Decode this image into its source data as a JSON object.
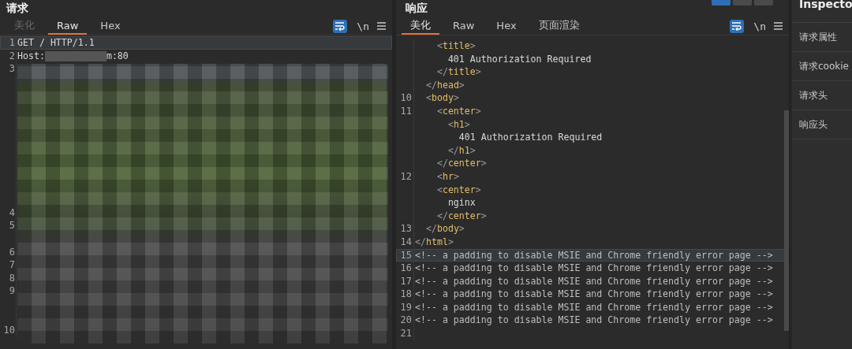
{
  "request": {
    "title": "请求",
    "tabs": [
      {
        "label": "美化",
        "selected": false,
        "disabled": true
      },
      {
        "label": "Raw",
        "selected": true,
        "disabled": false
      },
      {
        "label": "Hex",
        "selected": false,
        "disabled": false
      }
    ],
    "wrap_on": true,
    "newline_label": "\\n",
    "lines": [
      {
        "kind": "code",
        "num": "1",
        "text": "GET / HTTP/1.1",
        "current": true
      },
      {
        "kind": "host",
        "num": "2",
        "text": "Host:",
        "after": "m:80",
        "current": false
      },
      {
        "kind": "code",
        "num": "3",
        "current": false
      },
      {
        "kind": "wrap"
      },
      {
        "kind": "wrap"
      },
      {
        "kind": "wrap"
      },
      {
        "kind": "wrap"
      },
      {
        "kind": "wrap"
      },
      {
        "kind": "wrap"
      },
      {
        "kind": "wrap"
      },
      {
        "kind": "wrap"
      },
      {
        "kind": "wrap"
      },
      {
        "kind": "wrap"
      },
      {
        "kind": "code",
        "num": "4",
        "current": false
      },
      {
        "kind": "code",
        "num": "5",
        "current": false
      },
      {
        "kind": "wrap"
      },
      {
        "kind": "code",
        "num": "6",
        "current": false
      },
      {
        "kind": "code",
        "num": "7",
        "current": false
      },
      {
        "kind": "code",
        "num": "8",
        "current": false
      },
      {
        "kind": "code",
        "num": "9",
        "current": false
      },
      {
        "kind": "wrap"
      },
      {
        "kind": "wrap"
      },
      {
        "kind": "code",
        "num": "10",
        "current": false
      }
    ]
  },
  "response": {
    "title": "响应",
    "layout_toggles": [
      {
        "selected": true
      },
      {
        "selected": false
      },
      {
        "selected": false
      }
    ],
    "tabs": [
      {
        "label": "美化",
        "selected": true,
        "disabled": false
      },
      {
        "label": "Raw",
        "selected": false,
        "disabled": false
      },
      {
        "label": "Hex",
        "selected": false,
        "disabled": false
      },
      {
        "label": "页面渲染",
        "selected": false,
        "disabled": false
      }
    ],
    "wrap_on": true,
    "newline_label": "\\n",
    "lines": [
      {
        "kind": "tag",
        "text": "    <title>"
      },
      {
        "kind": "text",
        "text": "      401 Authorization Required"
      },
      {
        "kind": "tag",
        "text": "    </title>"
      },
      {
        "kind": "tag",
        "text": "  </head>"
      },
      {
        "kind": "tag",
        "num": "10",
        "text": "  <body>"
      },
      {
        "kind": "tag",
        "num": "11",
        "text": "    <center>"
      },
      {
        "kind": "tag",
        "text": "      <h1>"
      },
      {
        "kind": "text",
        "text": "        401 Authorization Required"
      },
      {
        "kind": "tag",
        "text": "      </h1>"
      },
      {
        "kind": "tag",
        "text": "    </center>"
      },
      {
        "kind": "tag",
        "num": "12",
        "text": "    <hr>"
      },
      {
        "kind": "tag",
        "text": "    <center>"
      },
      {
        "kind": "text",
        "text": "      nginx"
      },
      {
        "kind": "tag",
        "text": "    </center>"
      },
      {
        "kind": "tag",
        "num": "13",
        "text": "  </body>"
      },
      {
        "kind": "tag",
        "num": "14",
        "text": "</html>"
      },
      {
        "kind": "comment",
        "num": "15",
        "text": "<!-- a padding to disable MSIE and Chrome friendly error page -->",
        "current": true
      },
      {
        "kind": "comment",
        "num": "16",
        "text": "<!-- a padding to disable MSIE and Chrome friendly error page -->",
        "current": false
      },
      {
        "kind": "comment",
        "num": "17",
        "text": "<!-- a padding to disable MSIE and Chrome friendly error page -->",
        "current": false
      },
      {
        "kind": "comment",
        "num": "18",
        "text": "<!-- a padding to disable MSIE and Chrome friendly error page -->",
        "current": false
      },
      {
        "kind": "comment",
        "num": "19",
        "text": "<!-- a padding to disable MSIE and Chrome friendly error page -->",
        "current": false
      },
      {
        "kind": "comment",
        "num": "20",
        "text": "<!-- a padding to disable MSIE and Chrome friendly error page -->",
        "current": false
      },
      {
        "num": "21"
      }
    ]
  },
  "inspector": {
    "title": "Inspecto",
    "items": [
      "请求属性",
      "请求cookie",
      "请求头",
      "响应头"
    ]
  }
}
